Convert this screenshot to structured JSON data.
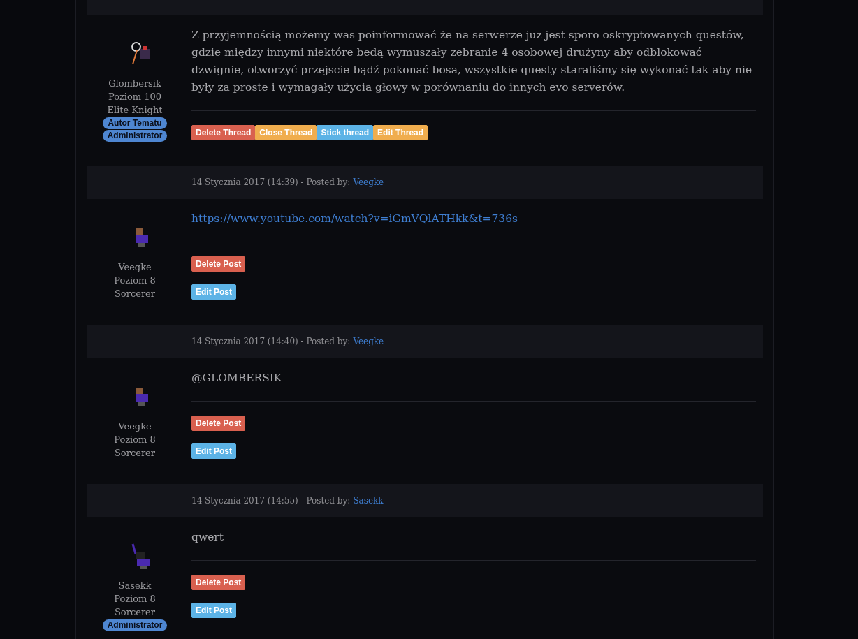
{
  "posts": [
    {
      "user": {
        "name": "Glombersik",
        "level": "Poziom 100",
        "vocation": "Elite Knight"
      },
      "avatar": {
        "kind": "knight"
      },
      "badges": [
        "Autor Tematu",
        "Administrator"
      ],
      "content": {
        "kind": "text",
        "text": "Z przyjemnością możemy was poinformować że na serwerze juz jest sporo oskryptowanych questów, gdzie między innymi niektóre bedą wymuszały zebranie 4 osobowej drużyny aby odblokować dzwignie, otworzyć przejscie bądź pokonać bosa, wszystkie questy staraliśmy się wykonać tak aby nie były za proste i wymagały użycia głowy w porównaniu do innych evo serverów."
      },
      "actions": {
        "kind": "row",
        "buttons": [
          {
            "label": "Delete Thread",
            "kind": "danger"
          },
          {
            "label": "Close Thread",
            "kind": "warning"
          },
          {
            "label": "Stick thread",
            "kind": "info"
          },
          {
            "label": "Edit Thread",
            "kind": "warning"
          }
        ]
      }
    },
    {
      "header": {
        "date": "14 Stycznia 2017 (14:39) - Posted by:",
        "author": "Veegke"
      },
      "user": {
        "name": "Veegke",
        "level": "Poziom 8",
        "vocation": "Sorcerer"
      },
      "avatar": {
        "kind": "mage"
      },
      "content": {
        "kind": "link",
        "text": "https://www.youtube.com/watch?v=iGmVQlATHkk&t=736s"
      },
      "actions": {
        "kind": "stack",
        "buttons": [
          {
            "label": "Delete Post",
            "kind": "danger"
          },
          {
            "label": "Edit Post",
            "kind": "info"
          }
        ]
      }
    },
    {
      "header": {
        "date": "14 Stycznia 2017 (14:40) - Posted by:",
        "author": "Veegke"
      },
      "user": {
        "name": "Veegke",
        "level": "Poziom 8",
        "vocation": "Sorcerer"
      },
      "avatar": {
        "kind": "mage"
      },
      "content": {
        "kind": "text",
        "text": "@GLOMBERSIK"
      },
      "actions": {
        "kind": "stack",
        "buttons": [
          {
            "label": "Delete Post",
            "kind": "danger"
          },
          {
            "label": "Edit Post",
            "kind": "info"
          }
        ]
      }
    },
    {
      "header": {
        "date": "14 Stycznia 2017 (14:55) - Posted by:",
        "author": "Sasekk"
      },
      "user": {
        "name": "Sasekk",
        "level": "Poziom 8",
        "vocation": "Sorcerer"
      },
      "avatar": {
        "kind": "hat"
      },
      "badges": [
        "Administrator"
      ],
      "content": {
        "kind": "text",
        "text": "qwert"
      },
      "actions": {
        "kind": "stack",
        "buttons": [
          {
            "label": "Delete Post",
            "kind": "danger"
          },
          {
            "label": "Edit Post",
            "kind": "info"
          }
        ]
      }
    }
  ]
}
